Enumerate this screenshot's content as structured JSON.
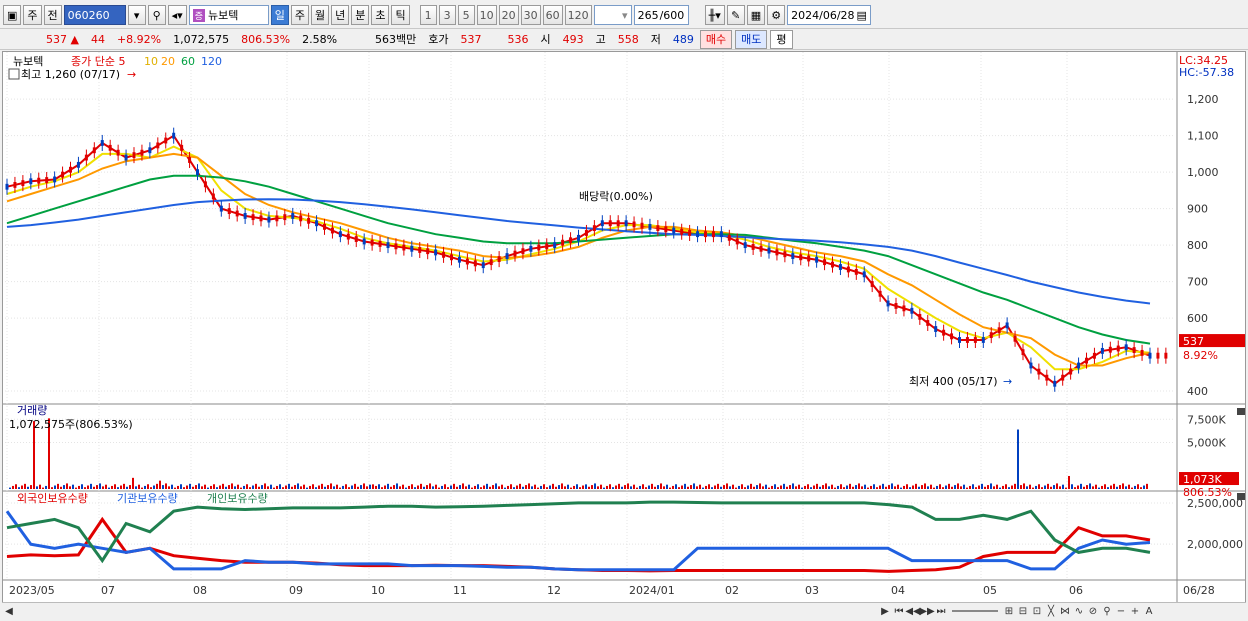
{
  "toolbar": {
    "mode": "주",
    "prev": "전",
    "code": "060260",
    "name": "뉴보텍",
    "periods": [
      "일",
      "주",
      "월",
      "년",
      "분",
      "초",
      "틱"
    ],
    "minutes": [
      "1",
      "3",
      "5",
      "10",
      "20",
      "30",
      "60",
      "120"
    ],
    "count": "265",
    "count_total": "/600",
    "date": "2024/06/28"
  },
  "quote": {
    "price": "537",
    "change_arrow": "▲",
    "change": "44",
    "change_pct": "+8.92%",
    "volume": "1,072,575",
    "volume_pct": "806.53%",
    "turnover": "2.58%",
    "amount": "563백만",
    "hoga_label": "호가",
    "ask": "537",
    "bid": "536",
    "open_label": "시",
    "open": "493",
    "high_label": "고",
    "high": "558",
    "low_label": "저",
    "low": "489",
    "buy_label": "매수",
    "sell_label": "매도",
    "eval_label": "평"
  },
  "colors": {
    "ma5": "#e00000",
    "ma10": "#ffd000",
    "ma20": "#ff9900",
    "ma60": "#00a040",
    "ma120": "#2060e0",
    "up": "#e00000",
    "down": "#0040c0"
  },
  "chart_data": [
    {
      "type": "line",
      "title": "뉴보텍",
      "legend": [
        "종가 단순 5",
        "10",
        "20",
        "60",
        "120"
      ],
      "right_labels": [
        "LC:34.25",
        "HC:-57.38"
      ],
      "annotations": [
        "최고 1,260 (07/17)",
        "배당락(0.00%)",
        "최저 400 (05/17)"
      ],
      "y_ticks": [
        1200,
        1100,
        1000,
        900,
        800,
        700,
        600,
        537,
        400
      ],
      "last_price_label": "537",
      "last_pct_label": "8.92%",
      "ylim": [
        370,
        1280
      ],
      "x_ticks": [
        "2023/05",
        "07",
        "08",
        "09",
        "10",
        "11",
        "12",
        "2024/01",
        "02",
        "03",
        "04",
        "05",
        "06",
        "06/28"
      ],
      "series": [
        {
          "name": "5",
          "values": [
            960,
            975,
            980,
            1020,
            1080,
            1040,
            1060,
            1100,
            1000,
            900,
            880,
            870,
            880,
            860,
            830,
            810,
            800,
            790,
            780,
            760,
            745,
            770,
            790,
            800,
            820,
            860,
            860,
            850,
            840,
            830,
            830,
            800,
            785,
            770,
            760,
            740,
            720,
            640,
            620,
            570,
            540,
            540,
            580,
            470,
            420,
            470,
            510,
            520,
            497
          ]
        },
        {
          "name": "10",
          "values": [
            940,
            960,
            975,
            1000,
            1050,
            1050,
            1040,
            1070,
            1040,
            950,
            900,
            880,
            875,
            865,
            845,
            820,
            805,
            795,
            785,
            770,
            755,
            760,
            775,
            790,
            810,
            840,
            855,
            855,
            845,
            835,
            830,
            815,
            795,
            780,
            770,
            755,
            735,
            680,
            640,
            600,
            565,
            545,
            560,
            520,
            460,
            460,
            480,
            510,
            505
          ]
        },
        {
          "name": "20",
          "values": [
            920,
            940,
            960,
            980,
            1010,
            1030,
            1040,
            1050,
            1040,
            990,
            940,
            910,
            890,
            875,
            860,
            840,
            820,
            805,
            795,
            785,
            770,
            765,
            770,
            780,
            795,
            820,
            840,
            850,
            850,
            840,
            835,
            825,
            810,
            795,
            780,
            770,
            755,
            720,
            690,
            650,
            610,
            575,
            560,
            545,
            500,
            470,
            470,
            490,
            505
          ]
        },
        {
          "name": "60",
          "values": [
            860,
            880,
            900,
            920,
            940,
            960,
            980,
            990,
            990,
            985,
            975,
            960,
            940,
            920,
            900,
            880,
            860,
            845,
            830,
            820,
            810,
            805,
            805,
            805,
            810,
            815,
            820,
            825,
            830,
            830,
            830,
            828,
            820,
            812,
            805,
            795,
            785,
            770,
            745,
            720,
            695,
            670,
            650,
            625,
            600,
            575,
            555,
            540,
            530
          ]
        },
        {
          "name": "120",
          "values": [
            850,
            855,
            862,
            870,
            880,
            890,
            900,
            910,
            918,
            922,
            925,
            926,
            925,
            922,
            918,
            912,
            905,
            898,
            890,
            882,
            874,
            866,
            860,
            854,
            848,
            843,
            838,
            834,
            830,
            828,
            825,
            822,
            818,
            815,
            812,
            808,
            802,
            795,
            785,
            770,
            752,
            735,
            718,
            700,
            685,
            670,
            658,
            648,
            640
          ]
        }
      ]
    },
    {
      "type": "bar",
      "title": "거래량",
      "value_label": "1,072,575주(806.53%)",
      "y_ticks": [
        "7,500K",
        "5,000K",
        "1,073K",
        "806.53%"
      ],
      "ylim": [
        0,
        8500
      ]
    },
    {
      "type": "line",
      "legend": [
        "외국인보유수량",
        "기관보유수량",
        "개인보유수량"
      ],
      "y_ticks": [
        "2,500,000",
        "2,000,000"
      ],
      "series": [
        {
          "name": "외국인보유수량",
          "values": [
            1850,
            1870,
            1860,
            1870,
            2300,
            1900,
            1950,
            1860,
            1830,
            1800,
            1780,
            1780,
            1780,
            1770,
            1750,
            1740,
            1740,
            1740,
            1745,
            1740,
            1740,
            1730,
            1720,
            1700,
            1690,
            1680,
            1680,
            1675,
            1680,
            1680,
            1680,
            1680,
            1680,
            1680,
            1680,
            1680,
            1680,
            1670,
            1680,
            1690,
            1720,
            1850,
            1900,
            1900,
            1900,
            2200,
            2100,
            2100,
            2050
          ]
        },
        {
          "name": "기관보유수량",
          "values": [
            2400,
            2000,
            1950,
            2000,
            1950,
            1900,
            1950,
            1700,
            1700,
            1700,
            1800,
            1780,
            1780,
            1760,
            1760,
            1760,
            1760,
            1740,
            1740,
            1740,
            1730,
            1720,
            1720,
            1700,
            1690,
            1690,
            1690,
            1690,
            1690,
            1950,
            1950,
            1950,
            1950,
            1950,
            1950,
            1950,
            1950,
            1950,
            1800,
            1800,
            1800,
            1800,
            1800,
            1700,
            1700,
            1950,
            2050,
            2000,
            2020
          ]
        },
        {
          "name": "개인보유수량",
          "values": [
            2200,
            2250,
            2300,
            2200,
            1800,
            2250,
            2150,
            2400,
            2450,
            2430,
            2420,
            2430,
            2440,
            2440,
            2440,
            2450,
            2460,
            2460,
            2450,
            2455,
            2460,
            2470,
            2480,
            2490,
            2500,
            2500,
            2500,
            2510,
            2510,
            2505,
            2500,
            2500,
            2500,
            2500,
            2500,
            2500,
            2500,
            2480,
            2450,
            2300,
            2300,
            2350,
            2300,
            2400,
            2050,
            1900,
            1950,
            1950,
            1900
          ]
        }
      ]
    }
  ]
}
